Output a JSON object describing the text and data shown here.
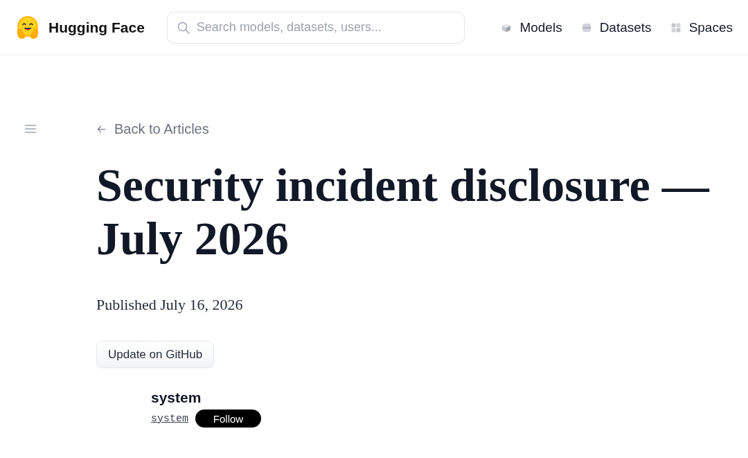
{
  "header": {
    "logo_text": "Hugging Face",
    "search": {
      "placeholder": "Search models, datasets, users..."
    },
    "nav": [
      {
        "label": "Models",
        "kind": "models"
      },
      {
        "label": "Datasets",
        "kind": "datasets"
      },
      {
        "label": "Spaces",
        "kind": "spaces"
      }
    ]
  },
  "article": {
    "back_link": "Back to Articles",
    "title": "Security incident disclosure — July 2026",
    "published": "Published July 16, 2026",
    "github_button": "Update on GitHub",
    "author": {
      "name": "system",
      "username": "system",
      "follow_button": "Follow"
    }
  }
}
